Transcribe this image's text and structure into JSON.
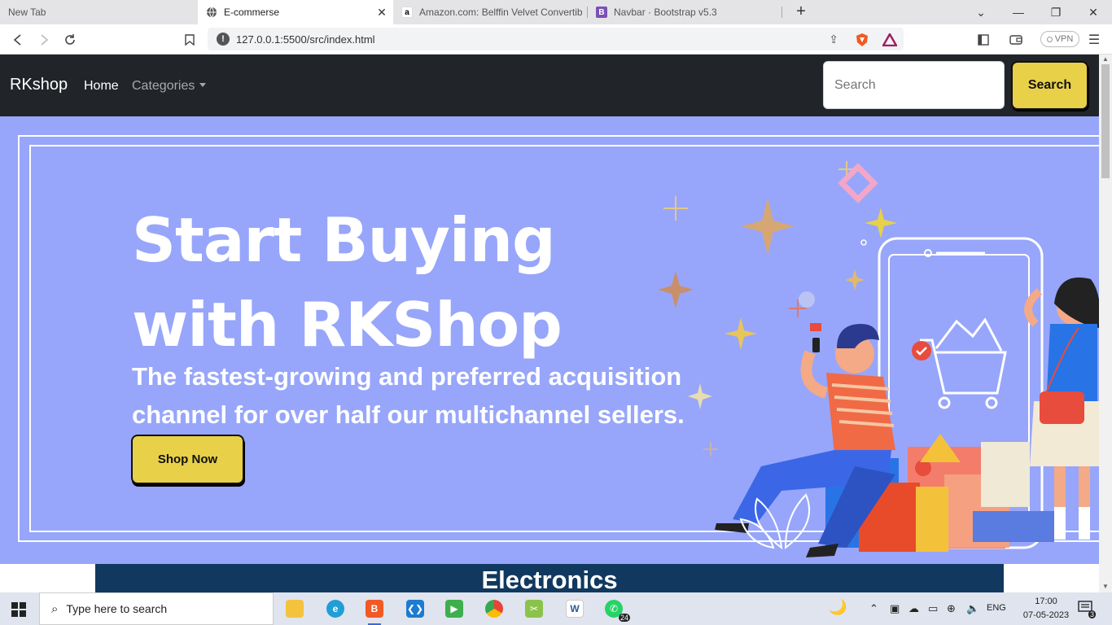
{
  "browser": {
    "tabs": [
      {
        "title": "New Tab",
        "active": false
      },
      {
        "title": "E-commerse",
        "active": true
      },
      {
        "title": "Amazon.com: Belffin Velvet Convertible",
        "active": false,
        "favicon": "a"
      },
      {
        "title": "Navbar · Bootstrap v5.3",
        "active": false,
        "favicon": "B"
      }
    ],
    "url": "127.0.0.1:5500/src/index.html",
    "vpn_label": "VPN"
  },
  "navbar": {
    "brand": "RKshop",
    "links": [
      {
        "label": "Home",
        "active": true
      },
      {
        "label": "Categories",
        "dropdown": true
      }
    ],
    "search_placeholder": "Search",
    "search_button": "Search"
  },
  "hero": {
    "title_line1": "Start Buying",
    "title_line2": "with RKShop",
    "subtitle_line1": "The fastest-growing and preferred acquisition",
    "subtitle_line2": "channel for over half our multichannel sellers.",
    "cta": "Shop Now",
    "illustration": "shopping-illustration"
  },
  "section": {
    "title": "Electronics"
  },
  "taskbar": {
    "search_placeholder": "Type here to search",
    "apps": [
      "file-explorer",
      "edge",
      "brave",
      "vscode",
      "facetime",
      "chrome",
      "snip",
      "word",
      "whatsapp"
    ],
    "whatsapp_badge": "24",
    "language": "ENG",
    "time": "17:00",
    "date": "07-05-2023",
    "notifications": "3"
  },
  "colors": {
    "navbar_bg": "#212529",
    "hero_bg": "#97a6fa",
    "button_yellow": "#e8d049",
    "section_bg": "#113960"
  }
}
